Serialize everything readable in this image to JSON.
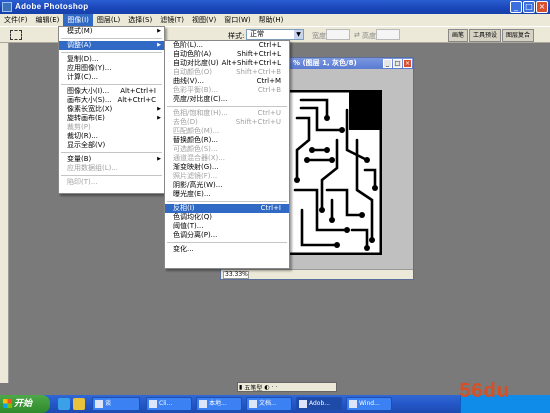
{
  "titlebar": {
    "title": "Adobe Photoshop",
    "min": "_",
    "max": "□",
    "close": "×"
  },
  "menubar": [
    "文件(F)",
    "编辑(E)",
    "图像(I)",
    "图层(L)",
    "选择(S)",
    "滤镜(T)",
    "视图(V)",
    "窗口(W)",
    "帮助(H)"
  ],
  "options": {
    "style_label": "样式:",
    "style_value": "正常",
    "width_label": "宽度:",
    "height_label": "高度:",
    "palette_tabs": [
      "画笔",
      "工具预设",
      "图层复合"
    ]
  },
  "document": {
    "title": "% (图层 1, 灰色/8)",
    "zoom": "33.33%"
  },
  "image_menu": [
    {
      "label": "模式(M)",
      "sub": "▶"
    },
    {
      "sep": true
    },
    {
      "label": "调整(A)",
      "sub": "▶",
      "hl": true
    },
    {
      "sep": true
    },
    {
      "label": "复制(D)..."
    },
    {
      "label": "应用图像(Y)..."
    },
    {
      "label": "计算(C)..."
    },
    {
      "sep": true
    },
    {
      "label": "图像大小(I)...",
      "sc": "Alt+Ctrl+I"
    },
    {
      "label": "画布大小(S)...",
      "sc": "Alt+Ctrl+C"
    },
    {
      "label": "像素长宽比(X)",
      "sub": "▶"
    },
    {
      "label": "旋转画布(E)",
      "sub": "▶"
    },
    {
      "label": "裁剪(P)",
      "dis": true
    },
    {
      "label": "裁切(R)..."
    },
    {
      "label": "显示全部(V)"
    },
    {
      "sep": true
    },
    {
      "label": "变量(B)",
      "sub": "▶"
    },
    {
      "label": "应用数据组(L)...",
      "dis": true
    },
    {
      "sep": true
    },
    {
      "label": "陷印(T)...",
      "dis": true
    }
  ],
  "adjust_menu": [
    {
      "label": "色阶(L)...",
      "sc": "Ctrl+L"
    },
    {
      "label": "自动色阶(A)",
      "sc": "Shift+Ctrl+L"
    },
    {
      "label": "自动对比度(U)",
      "sc": "Alt+Shift+Ctrl+L"
    },
    {
      "label": "自动颜色(O)",
      "sc": "Shift+Ctrl+B",
      "dis": true
    },
    {
      "label": "曲线(V)...",
      "sc": "Ctrl+M"
    },
    {
      "label": "色彩平衡(B)...",
      "sc": "Ctrl+B",
      "dis": true
    },
    {
      "label": "亮度/对比度(C)..."
    },
    {
      "sep": true
    },
    {
      "label": "色相/饱和度(H)...",
      "sc": "Ctrl+U",
      "dis": true
    },
    {
      "label": "去色(D)",
      "sc": "Shift+Ctrl+U",
      "dis": true
    },
    {
      "label": "匹配颜色(M)...",
      "dis": true
    },
    {
      "label": "替换颜色(R)..."
    },
    {
      "label": "可选颜色(S)...",
      "dis": true
    },
    {
      "label": "通道混合器(X)...",
      "dis": true
    },
    {
      "label": "渐变映射(G)..."
    },
    {
      "label": "照片滤镜(F)...",
      "dis": true
    },
    {
      "label": "阴影/高光(W)..."
    },
    {
      "label": "曝光度(E)..."
    },
    {
      "sep": true
    },
    {
      "label": "反相(I)",
      "sc": "Ctrl+I",
      "hl": true
    },
    {
      "label": "色调均化(Q)"
    },
    {
      "label": "阈值(T)..."
    },
    {
      "label": "色调分离(P)..."
    },
    {
      "sep": true
    },
    {
      "label": "变化..."
    }
  ],
  "bottom_toolbar": [
    "▮",
    "五笔型",
    "◐",
    "·",
    "·"
  ],
  "taskbar": {
    "start": "开始",
    "tasks": [
      "谈",
      "Cli...",
      "本地...",
      "文档...",
      "Adob...",
      "Wind..."
    ],
    "watermark": "56du"
  }
}
